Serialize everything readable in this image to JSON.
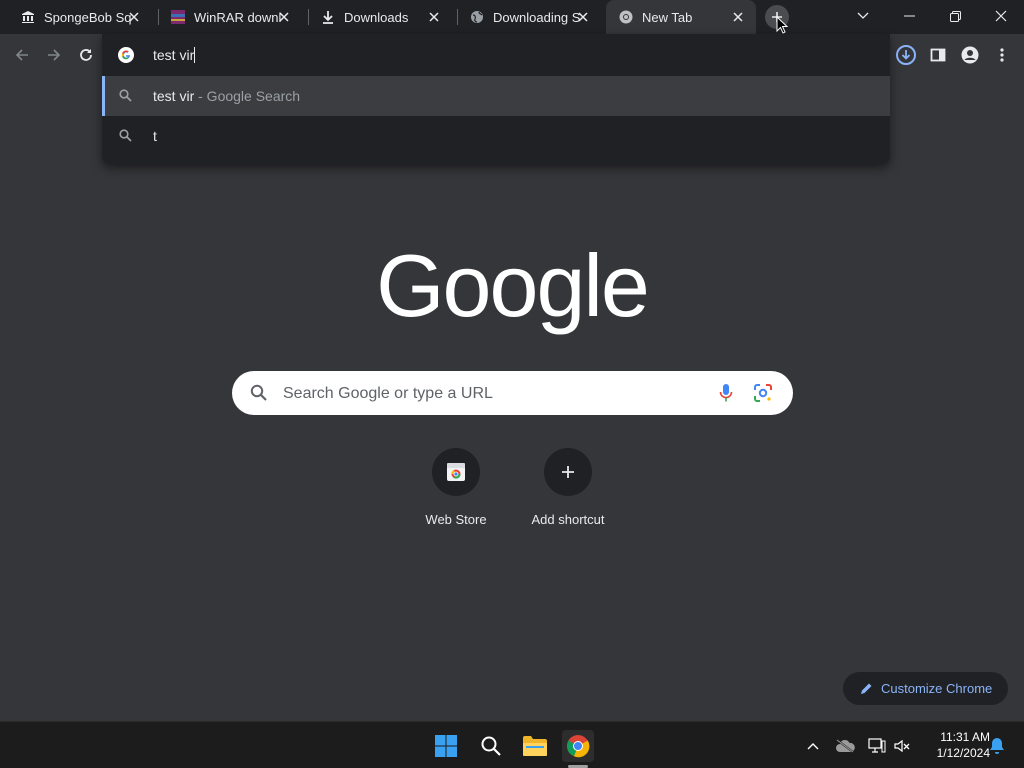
{
  "tabs": [
    {
      "title": "SpongeBob Squ",
      "icon": "museum-icon"
    },
    {
      "title": "WinRAR downlo",
      "icon": "winrar-icon"
    },
    {
      "title": "Downloads",
      "icon": "download-icon"
    },
    {
      "title": "Downloading S",
      "icon": "globe-icon"
    },
    {
      "title": "New Tab",
      "icon": "chrome-icon",
      "active": true
    }
  ],
  "omnibox": {
    "input_value": "test vir",
    "suggestions": [
      {
        "main": "test vir",
        "suffix": " - Google Search",
        "selected": true
      },
      {
        "main": "t",
        "suffix": ""
      }
    ]
  },
  "ntp": {
    "logo_text": "Google",
    "search_placeholder": "Search Google or type a URL",
    "shortcuts": [
      {
        "label": "Web Store"
      },
      {
        "label": "Add shortcut"
      }
    ],
    "customize_label": "Customize Chrome"
  },
  "taskbar": {
    "time": "11:31 AM",
    "date": "1/12/2024"
  },
  "colors": {
    "accent": "#8ab4f8",
    "tabstrip": "#202124",
    "page_bg": "#35363a"
  }
}
